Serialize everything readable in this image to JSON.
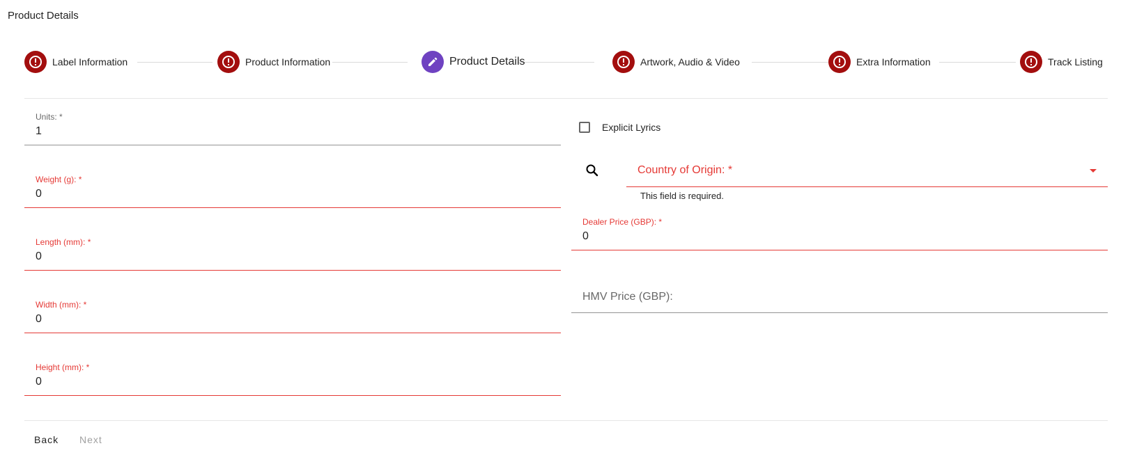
{
  "page": {
    "title": "Product Details"
  },
  "stepper": {
    "steps": [
      {
        "label": "Label Information",
        "state": "error",
        "icon": "alert-circle-icon"
      },
      {
        "label": "Product Information",
        "state": "error",
        "icon": "alert-circle-icon"
      },
      {
        "label": "Product Details",
        "state": "active",
        "icon": "pencil-icon"
      },
      {
        "label": "Artwork, Audio & Video",
        "state": "error",
        "icon": "alert-circle-icon"
      },
      {
        "label": "Extra Information",
        "state": "error",
        "icon": "alert-circle-icon"
      },
      {
        "label": "Track Listing",
        "state": "error",
        "icon": "alert-circle-icon"
      }
    ],
    "error_color": "#a30e0e",
    "active_color": "#6f42c1"
  },
  "form": {
    "units": {
      "label": "Units: *",
      "value": "1"
    },
    "weight": {
      "label": "Weight (g): *",
      "value": "0"
    },
    "length": {
      "label": "Length (mm): *",
      "value": "0"
    },
    "width": {
      "label": "Width (mm): *",
      "value": "0"
    },
    "height": {
      "label": "Height (mm): *",
      "value": "0"
    },
    "explicit_lyrics": {
      "label": "Explicit Lyrics",
      "checked": false
    },
    "country": {
      "label": "Country of Origin: *",
      "helper": "This field is required.",
      "icon": "search-icon"
    },
    "dealer_price": {
      "label": "Dealer Price (GBP): *",
      "value": "0"
    },
    "hmv_price": {
      "label": "HMV Price (GBP):",
      "value": ""
    },
    "error_color": "#e53935"
  },
  "actions": {
    "back_label": "Back",
    "next_label": "Next"
  }
}
